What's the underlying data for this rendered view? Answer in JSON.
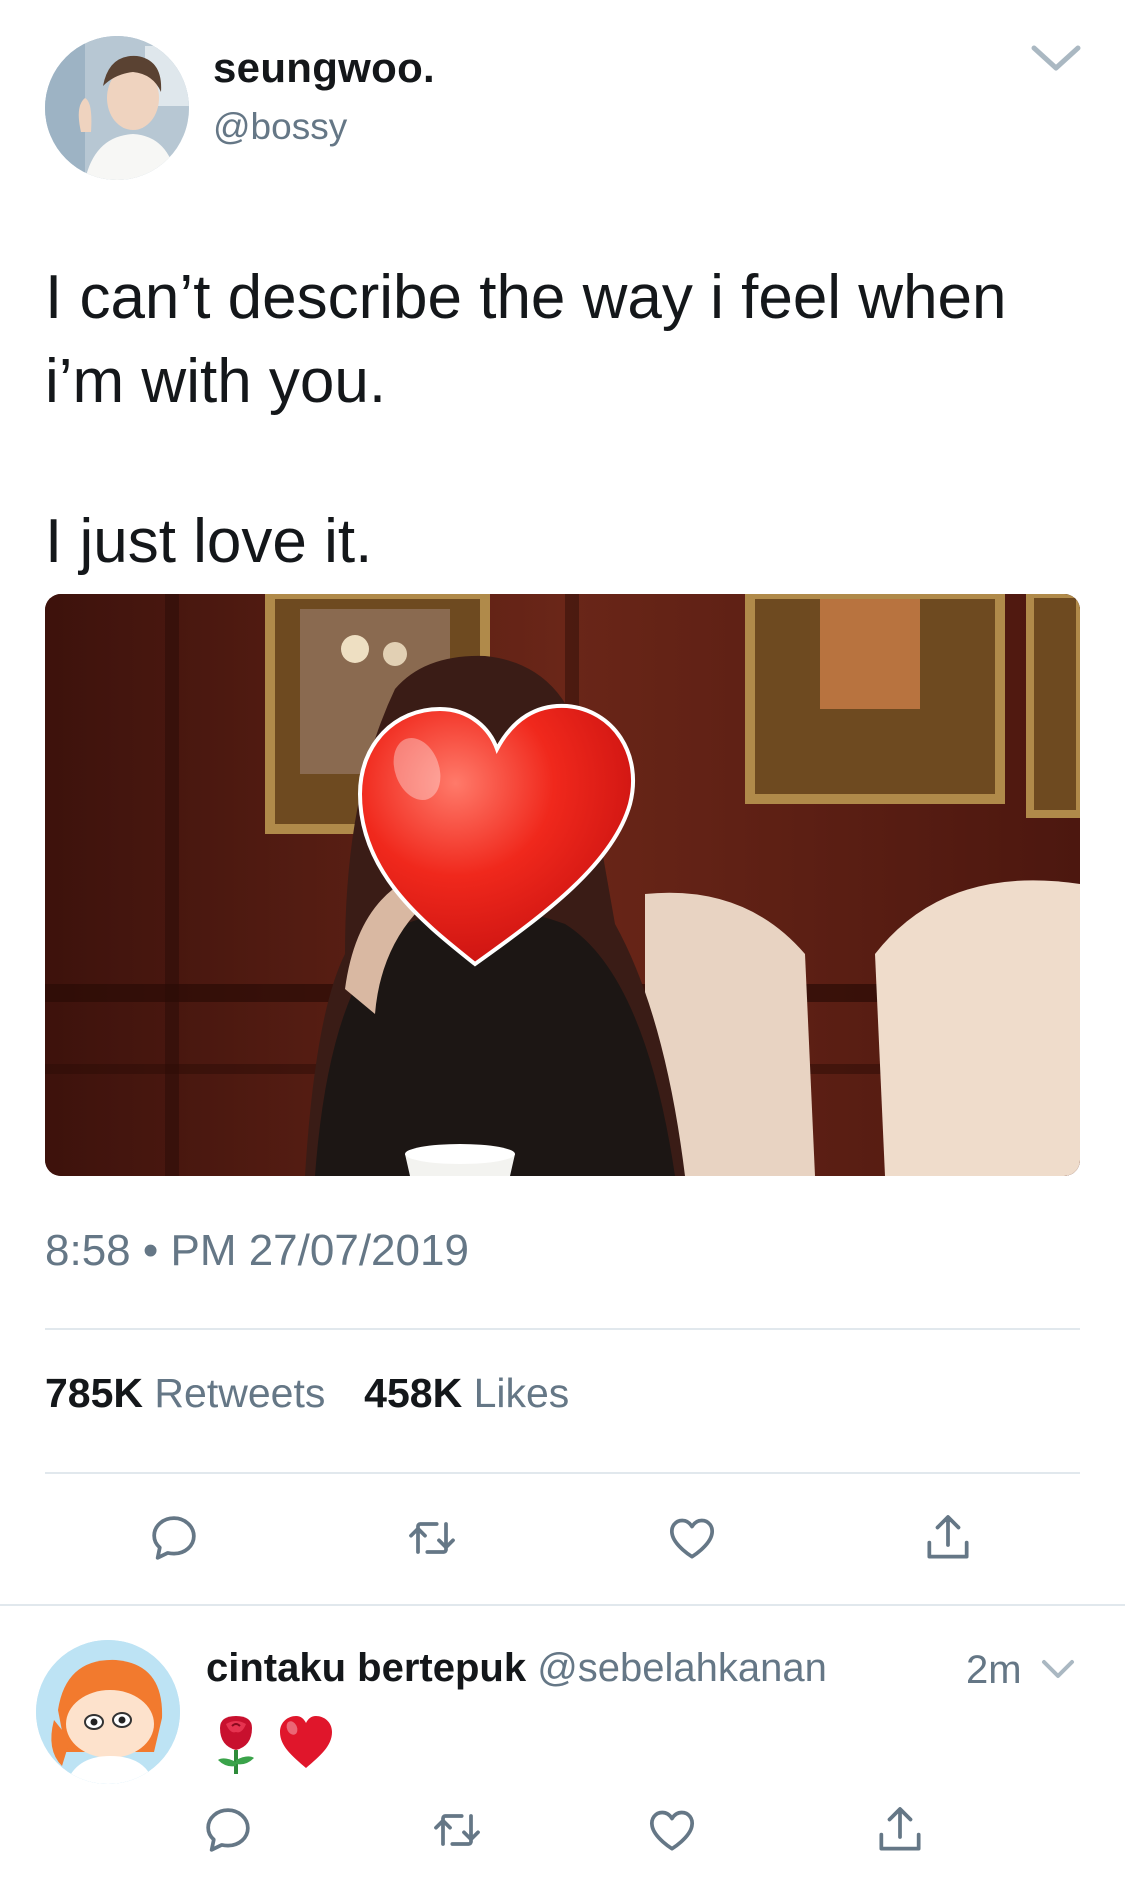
{
  "tweet": {
    "author_name": "seungwoo.",
    "author_handle": "@bossy",
    "text_line1": "I can’t describe the way i feel when",
    "text_line2": "i’m with you.",
    "text_line3": "I just love it.",
    "timestamp": "8:58 • PM 27/07/2019",
    "retweets_count": "785K",
    "retweets_label": "Retweets",
    "likes_count": "458K",
    "likes_label": "Likes"
  },
  "actions": {
    "reply_icon": "reply-icon",
    "retweet_icon": "retweet-icon",
    "like_icon": "heart-icon",
    "share_icon": "share-icon"
  },
  "reply": {
    "author_name": "cintaku bertepuk",
    "author_handle": "@sebelahkanan",
    "time": "2m",
    "emojis": [
      "rose-emoji",
      "red-heart-emoji"
    ]
  },
  "colors": {
    "text_primary": "#14171a",
    "text_secondary": "#657786",
    "divider": "#e1e8ed",
    "icon": "#657786",
    "heart_emoji": "#e0162b"
  }
}
